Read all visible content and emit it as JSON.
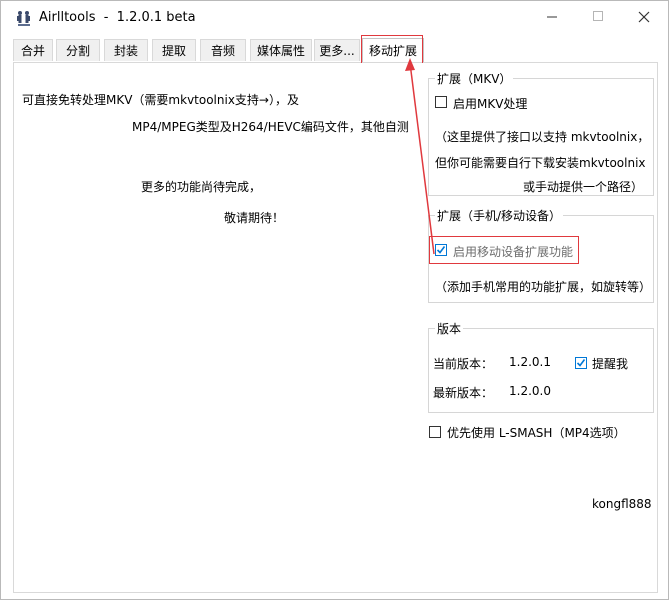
{
  "window": {
    "title": "Airlltools  -  1.2.0.1 beta",
    "icon": "app-figures-icon",
    "controls": [
      "minimize-icon",
      "maximize-icon",
      "close-icon"
    ]
  },
  "tabs": [
    {
      "label": "合并",
      "active": false
    },
    {
      "label": "分割",
      "active": false
    },
    {
      "label": "封装",
      "active": false
    },
    {
      "label": "提取",
      "active": false
    },
    {
      "label": "音频",
      "active": false
    },
    {
      "label": "媒体属性",
      "active": false
    },
    {
      "label": "更多...",
      "active": false
    },
    {
      "label": "移动扩展",
      "active": true
    }
  ],
  "left": {
    "line1": "可直接免转处理MKV（需要mkvtoolnix支持→），及",
    "line2": "MP4/MPEG类型及H264/HEVC编码文件，其他自测",
    "line3": "更多的功能尚待完成，",
    "line4": "敬请期待！"
  },
  "mkv_group": {
    "title": "扩展（MKV）",
    "checkbox_label": "启用MKV处理",
    "checked": false,
    "note1": "（这里提供了接口以支持 mkvtoolnix，",
    "note2": "但你可能需要自行下载安装mkvtoolnix",
    "note3": "或手动提供一个路径）"
  },
  "mobile_group": {
    "title": "扩展（手机/移动设备）",
    "checkbox_label": "启用移动设备扩展功能",
    "checked": true,
    "note": "（添加手机常用的功能扩展，如旋转等）"
  },
  "version_group": {
    "title": "版本",
    "current_label": "当前版本：",
    "current_value": "1.2.0.1",
    "remind_label": "提醒我",
    "remind_checked": true,
    "latest_label": "最新版本：",
    "latest_value": "1.2.0.0"
  },
  "lsmash": {
    "label": "优先使用 L-SMASH（MP4选项）",
    "checked": false
  },
  "author": "kongfl888",
  "annotation_color": "#e0393e",
  "accent_color": "#0078d7"
}
